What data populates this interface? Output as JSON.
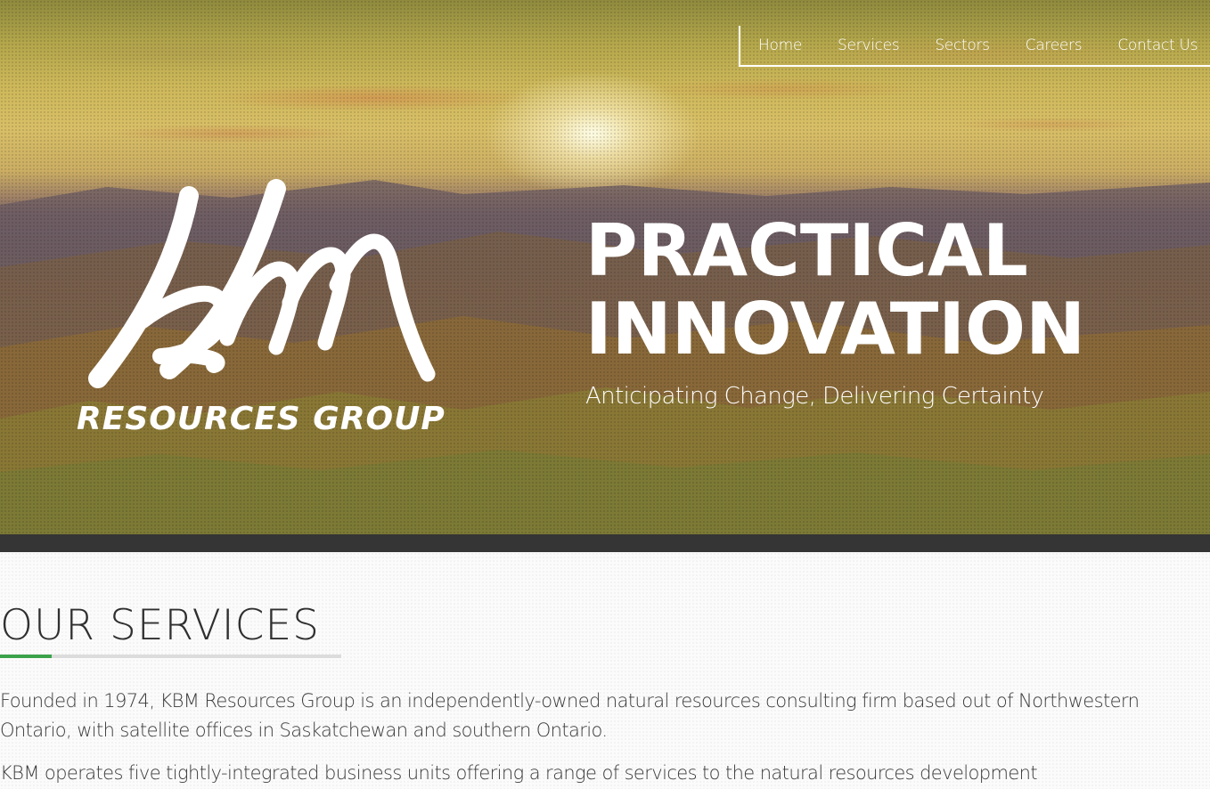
{
  "nav": {
    "items": [
      {
        "label": "Home"
      },
      {
        "label": "Services"
      },
      {
        "label": "Sectors"
      },
      {
        "label": "Careers"
      },
      {
        "label": "Contact Us"
      }
    ]
  },
  "hero": {
    "logo_mark": "KBM",
    "logo_subtitle": "RESOURCES GROUP",
    "headline_line1": "PRACTICAL",
    "headline_line2": "INNOVATION",
    "tagline": "Anticipating Change, Delivering Certainty"
  },
  "services": {
    "title": "OUR SERVICES",
    "accent_color": "#3aa34a",
    "paragraph1": "Founded in 1974, KBM Resources Group is an independently-owned natural resources consulting firm based out of Northwestern Ontario, with satellite offices in Saskatchewan and southern Ontario.",
    "paragraph2": "KBM operates five tightly-integrated business units offering a range of services to the natural resources development"
  }
}
